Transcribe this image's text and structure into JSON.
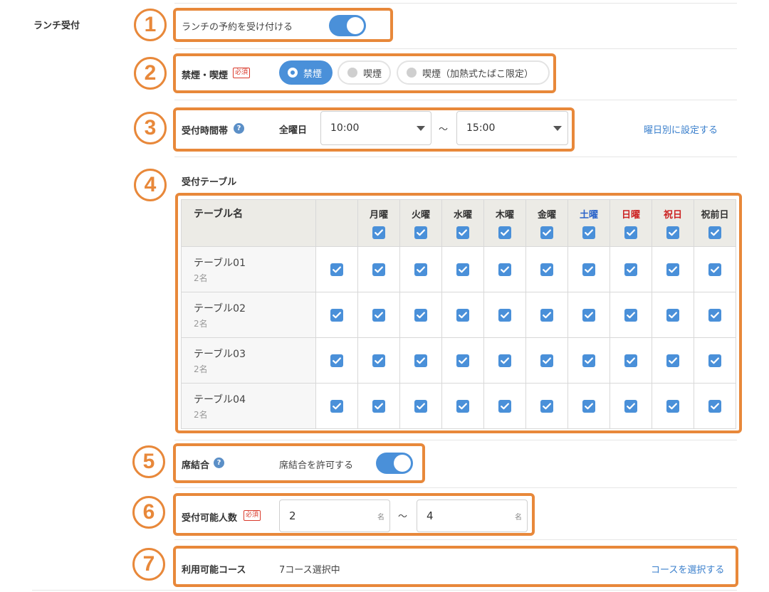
{
  "section": {
    "title": "ランチ受付"
  },
  "lunch": {
    "label": "ランチの予約を受け付ける",
    "enabled": true
  },
  "smoking": {
    "label": "禁煙・喫煙",
    "required_tag": "必須",
    "options": [
      {
        "label": "禁煙",
        "selected": true
      },
      {
        "label": "喫煙",
        "selected": false
      },
      {
        "label": "喫煙（加熱式たばこ限定）",
        "selected": false
      }
    ]
  },
  "hours": {
    "label": "受付時間帯",
    "help": "?",
    "day_label": "全曜日",
    "start": "10:00",
    "tilde": "〜",
    "end": "15:00",
    "per_day_link": "曜日別に設定する"
  },
  "tables": {
    "label": "受付テーブル",
    "name_header": "テーブル名",
    "days": [
      {
        "label": "月曜",
        "color": "normal",
        "checked": true
      },
      {
        "label": "火曜",
        "color": "normal",
        "checked": true
      },
      {
        "label": "水曜",
        "color": "normal",
        "checked": true
      },
      {
        "label": "木曜",
        "color": "normal",
        "checked": true
      },
      {
        "label": "金曜",
        "color": "normal",
        "checked": true
      },
      {
        "label": "土曜",
        "color": "#2a63c9",
        "checked": true
      },
      {
        "label": "日曜",
        "color": "#cc2222",
        "checked": true
      },
      {
        "label": "祝日",
        "color": "#cc2222",
        "checked": true
      },
      {
        "label": "祝前日",
        "color": "normal",
        "checked": true
      }
    ],
    "rows": [
      {
        "name": "テーブル01",
        "capacity": "2名",
        "all": true,
        "checks": [
          true,
          true,
          true,
          true,
          true,
          true,
          true,
          true,
          true
        ]
      },
      {
        "name": "テーブル02",
        "capacity": "2名",
        "all": true,
        "checks": [
          true,
          true,
          true,
          true,
          true,
          true,
          true,
          true,
          true
        ]
      },
      {
        "name": "テーブル03",
        "capacity": "2名",
        "all": true,
        "checks": [
          true,
          true,
          true,
          true,
          true,
          true,
          true,
          true,
          true
        ]
      },
      {
        "name": "テーブル04",
        "capacity": "2名",
        "all": true,
        "checks": [
          true,
          true,
          true,
          true,
          true,
          true,
          true,
          true,
          true
        ]
      }
    ]
  },
  "combine": {
    "label": "席結合",
    "help": "?",
    "toggle_label": "席結合を許可する",
    "enabled": true
  },
  "party": {
    "label": "受付可能人数",
    "required_tag": "必須",
    "min": "2",
    "max": "4",
    "unit": "名",
    "tilde": "〜"
  },
  "course": {
    "label": "利用可能コース",
    "value": "7コース選択中",
    "link": "コースを選択する"
  },
  "badges": [
    "1",
    "2",
    "3",
    "4",
    "5",
    "6",
    "7"
  ],
  "colors": {
    "accent": "#e8883a",
    "primary": "#4a90d9",
    "link": "#3a7fcc"
  }
}
